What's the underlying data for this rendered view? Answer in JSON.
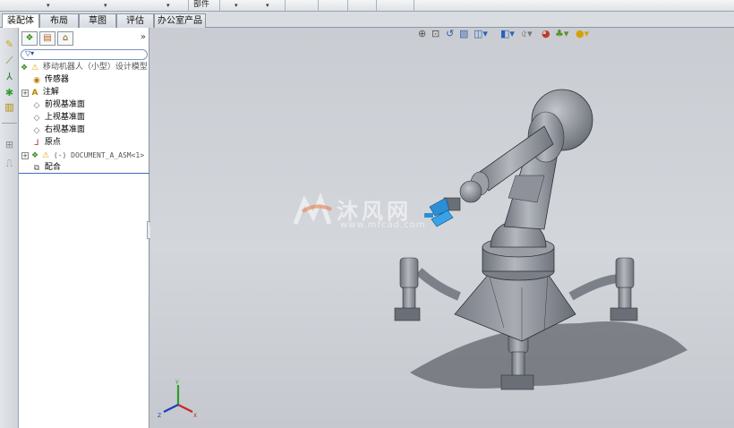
{
  "toolbar": {
    "parts_label": "部件"
  },
  "tabs": [
    {
      "label": "装配体"
    },
    {
      "label": "布局"
    },
    {
      "label": "草图"
    },
    {
      "label": "评估"
    },
    {
      "label": "办公室产品"
    }
  ],
  "feature_manager": {
    "expand_glyph": "»",
    "tree": [
      {
        "label": "移动机器人（小型）设计模型",
        "icon": "assembly-warning-icon"
      },
      {
        "label": "传感器",
        "icon": "sensor-icon"
      },
      {
        "label": "注解",
        "icon": "annotation-icon"
      },
      {
        "label": "前视基准面",
        "icon": "plane-icon"
      },
      {
        "label": "上视基准面",
        "icon": "plane-icon"
      },
      {
        "label": "右视基准面",
        "icon": "plane-icon"
      },
      {
        "label": "原点",
        "icon": "origin-icon"
      },
      {
        "label": "(-) DOCUMENT_A_ASM<1>",
        "icon": "subassembly-warning-icon"
      },
      {
        "label": "配合",
        "icon": "mates-icon"
      }
    ]
  },
  "watermark": {
    "text": "沐风网",
    "url": "www.mfcad.com"
  },
  "triad": {
    "x": "X",
    "y": "Y",
    "z": "Z"
  },
  "colors": {
    "tab_active_bg": "#ffffff",
    "tree_selection_line": "#3b6fc0",
    "model_body": "#8e9199",
    "gripper_accent": "#2b8fd6"
  }
}
